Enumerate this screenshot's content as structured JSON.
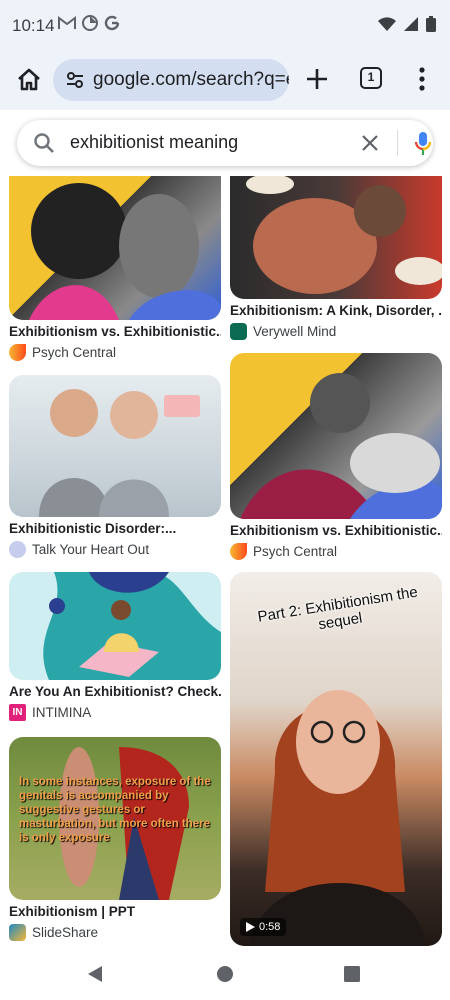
{
  "status_bar": {
    "time": "10:14",
    "notification_icons": [
      "gmail-icon",
      "photos-icon",
      "google-icon"
    ],
    "system_icons": [
      "wifi-icon",
      "signal-icon",
      "battery-icon"
    ]
  },
  "toolbar": {
    "url": "google.com/search?q=e",
    "tab_count": "1"
  },
  "search": {
    "query": "exhibitionist meaning"
  },
  "results": [
    {
      "title": "Exhibitionism vs. Exhibitionistic...",
      "source": "Psych Central",
      "source_icon": "psych-central-icon",
      "source_color": "#f5a623"
    },
    {
      "title": "Exhibitionism: A Kink, Disorder, ...",
      "source": "Verywell Mind",
      "source_icon": "verywell-mind-icon",
      "source_color": "#0b6b52"
    },
    {
      "title": "Exhibitionistic Disorder:...",
      "source": "Talk Your Heart Out",
      "source_icon": "talk-your-heart-out-icon",
      "source_color": "#9aa5d8"
    },
    {
      "title": "Exhibitionism vs. Exhibitionistic...",
      "source": "Psych Central",
      "source_icon": "psych-central-icon",
      "source_color": "#f5a623"
    },
    {
      "title": "Are You An Exhibitionist? Check...",
      "source": "INTIMINA",
      "source_icon": "intimina-icon",
      "source_color": "#e2227a"
    },
    {
      "title": "Exhibitionism | PPT",
      "source": "SlideShare",
      "source_icon": "slideshare-icon",
      "source_color": "#1e88c6"
    }
  ],
  "image_captions": {
    "slideshare_caption": "In some instances, exposure of the genitals is accompanied by suggestive gestures or masturbation, but more often there is only exposure",
    "video_overlay": "Part 2: Exhibitionism the sequel",
    "video_duration": "0:58"
  }
}
